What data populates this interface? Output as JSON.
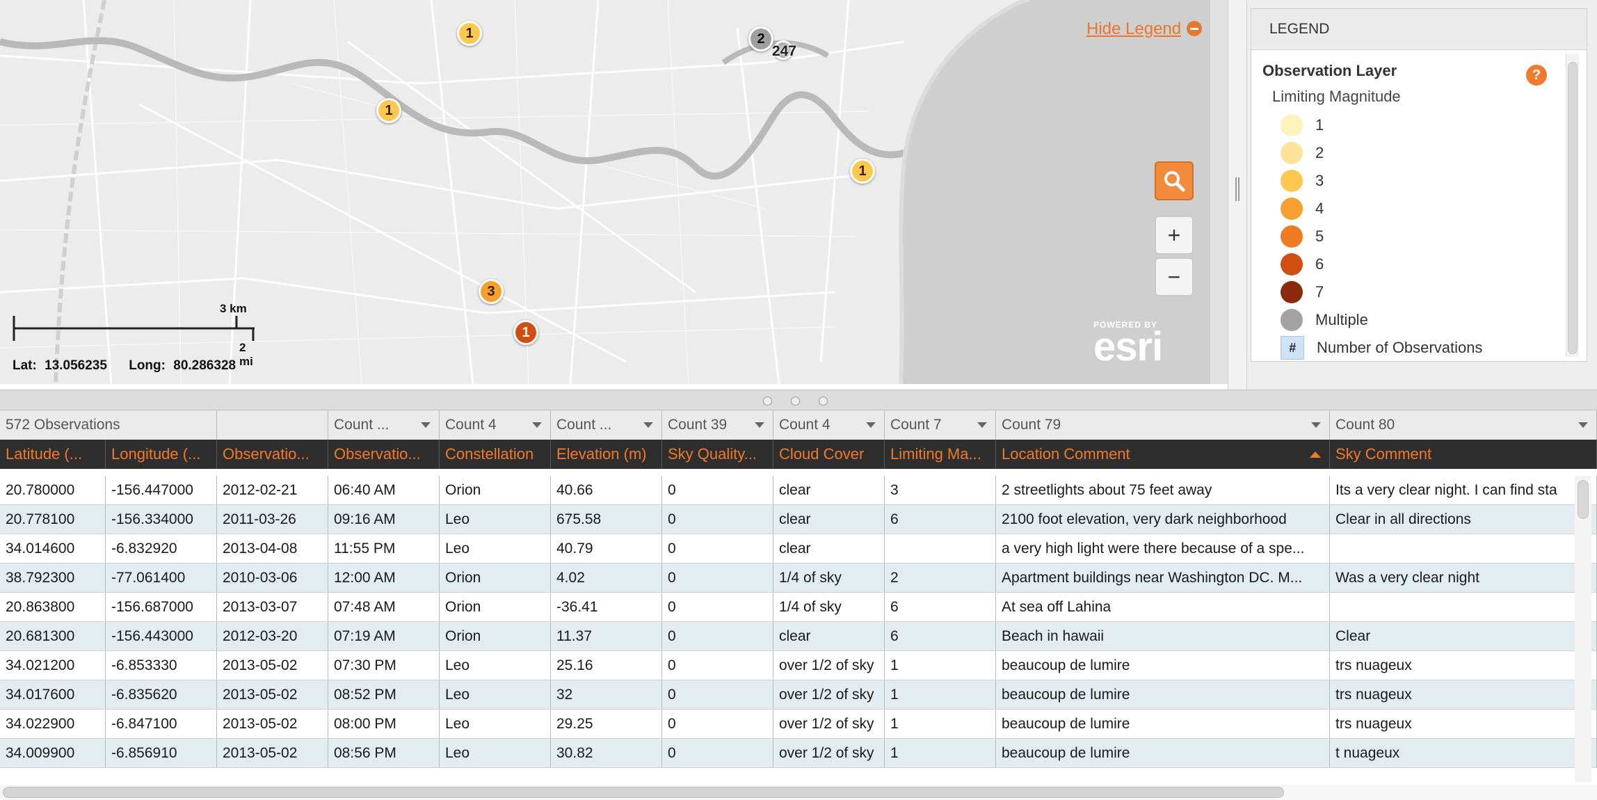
{
  "map": {
    "hide_legend_label": "Hide Legend",
    "scale_km": "3 km",
    "scale_mi": "2 mi",
    "lat_label": "Lat:",
    "lat_value": "13.056235",
    "long_label": "Long:",
    "long_value": "80.286328",
    "esri_powered_by": "POWERED BY",
    "esri_name": "esri",
    "zoom_in_label": "+",
    "zoom_out_label": "−",
    "markers": [
      {
        "label": "1",
        "magnitude": 3
      },
      {
        "label": "1",
        "magnitude": 3
      },
      {
        "label": "1",
        "magnitude": 3
      },
      {
        "label": "3",
        "magnitude": 4
      },
      {
        "label": "1",
        "magnitude": 6
      },
      {
        "label": "2",
        "magnitude": "Multiple"
      }
    ],
    "cluster_label": "247"
  },
  "legend": {
    "header": "LEGEND",
    "layer_title": "Observation Layer",
    "subtitle": "Limiting Magnitude",
    "help_icon": "?",
    "items": [
      {
        "label": "1",
        "color": "#fdf3bd"
      },
      {
        "label": "2",
        "color": "#fde39a"
      },
      {
        "label": "3",
        "color": "#fcc84f"
      },
      {
        "label": "4",
        "color": "#f7a030"
      },
      {
        "label": "5",
        "color": "#ee7a22"
      },
      {
        "label": "6",
        "color": "#cf4e10"
      },
      {
        "label": "7",
        "color": "#8a2a0c"
      },
      {
        "label": "Multiple",
        "color": "#a3a3a3"
      },
      {
        "label": "Number of Observations",
        "symbol": "#"
      }
    ]
  },
  "table": {
    "aggregates": [
      "572 Observations",
      "",
      "Count  ...",
      "Count  4",
      "Count  ...",
      "Count  39",
      "Count  4",
      "Count  7",
      "Count  79",
      "Count  80"
    ],
    "headers": [
      "Latitude (...",
      "Longitude (...",
      "Observatio...",
      "Observatio...",
      "Constellation",
      "Elevation (m)",
      "Sky Quality...",
      "Cloud Cover",
      "Limiting Ma...",
      "Location Comment",
      "Sky Comment"
    ],
    "rows": [
      [
        "20.780000",
        "-156.447000",
        "2012-02-21",
        "06:40 AM",
        "Orion",
        "40.66",
        "0",
        "clear",
        "3",
        "2 streetlights about 75 feet away",
        "Its a very clear night. I can find sta"
      ],
      [
        "20.778100",
        "-156.334000",
        "2011-03-26",
        "09:16 AM",
        "Leo",
        "675.58",
        "0",
        "clear",
        "6",
        "2100 foot elevation, very dark neighborhood",
        "Clear in all directions"
      ],
      [
        "34.014600",
        "-6.832920",
        "2013-04-08",
        "11:55 PM",
        "Leo",
        "40.79",
        "0",
        "clear",
        "",
        "a very high light were there because of a spe...",
        ""
      ],
      [
        "38.792300",
        "-77.061400",
        "2010-03-06",
        "12:00 AM",
        "Orion",
        "4.02",
        "0",
        "1/4 of sky",
        "2",
        "Apartment buildings near Washington DC. M...",
        "Was a very clear night"
      ],
      [
        "20.863800",
        "-156.687000",
        "2013-03-07",
        "07:48 AM",
        "Orion",
        "-36.41",
        "0",
        "1/4 of sky",
        "6",
        "At sea off Lahina",
        ""
      ],
      [
        "20.681300",
        "-156.443000",
        "2012-03-20",
        "07:19 AM",
        "Orion",
        "11.37",
        "0",
        "clear",
        "6",
        "Beach in hawaii",
        "Clear"
      ],
      [
        "34.021200",
        "-6.853330",
        "2013-05-02",
        "07:30 PM",
        "Leo",
        "25.16",
        "0",
        "over 1/2 of sky",
        "1",
        "beaucoup de lumire",
        "trs nuageux"
      ],
      [
        "34.017600",
        "-6.835620",
        "2013-05-02",
        "08:52 PM",
        "Leo",
        "32",
        "0",
        "over 1/2 of sky",
        "1",
        "beaucoup de lumire",
        "trs nuageux"
      ],
      [
        "34.022900",
        "-6.847100",
        "2013-05-02",
        "08:00 PM",
        "Leo",
        "29.25",
        "0",
        "over 1/2 of sky",
        "1",
        "beaucoup de lumire",
        "trs nuageux"
      ],
      [
        "34.009900",
        "-6.856910",
        "2013-05-02",
        "08:56 PM",
        "Leo",
        "30.82",
        "0",
        "over 1/2 of sky",
        "1",
        "beaucoup de lumire",
        "t nuageux"
      ]
    ]
  }
}
